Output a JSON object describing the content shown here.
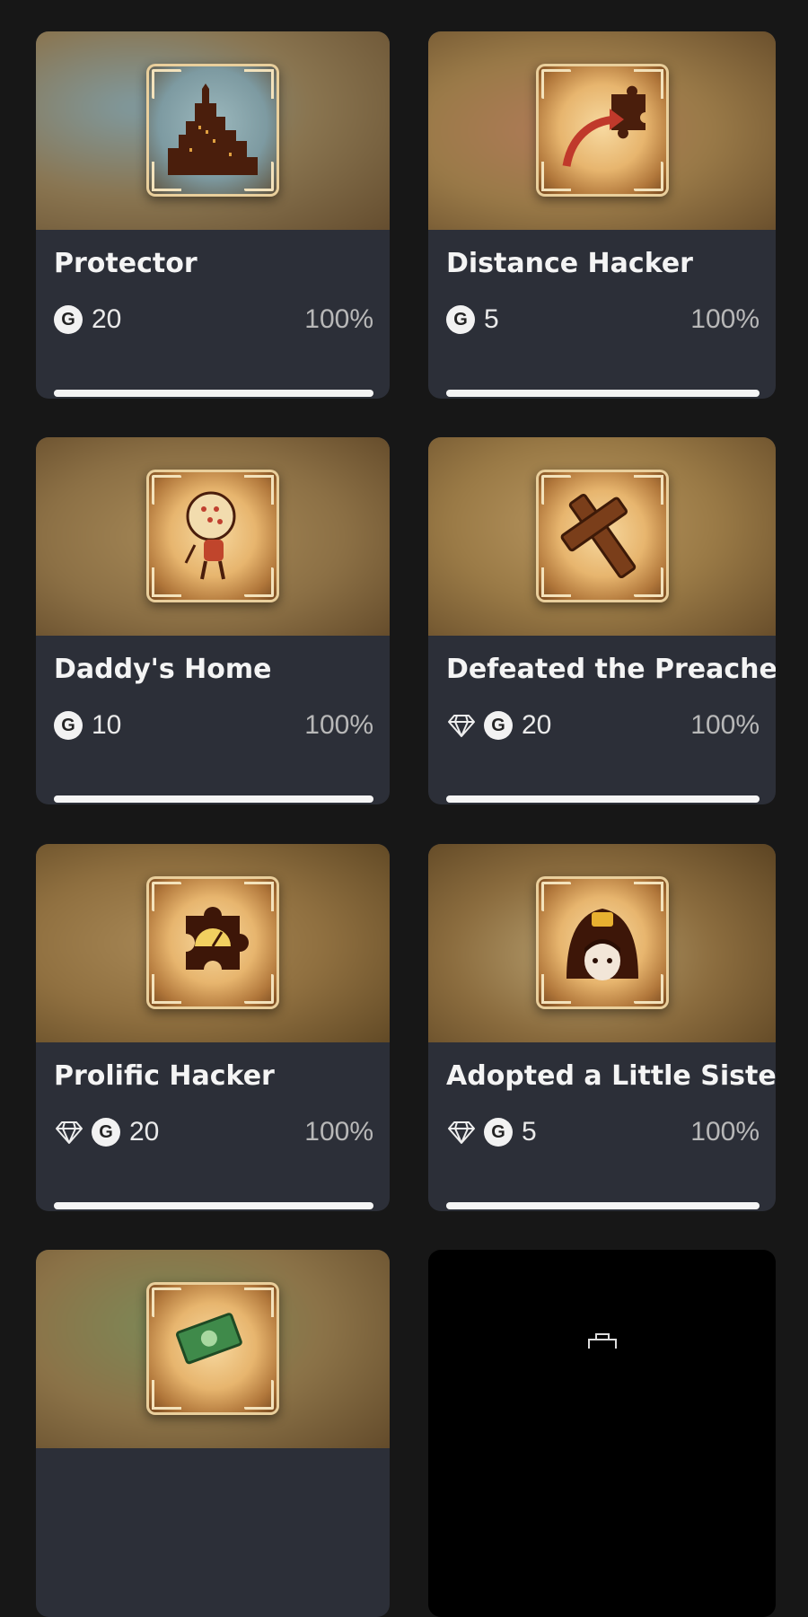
{
  "achievements": [
    {
      "title": "Protector",
      "score": "20",
      "rare": false,
      "percent": "100%",
      "progress": 1.0,
      "icon": "city-icon",
      "bg": "#8a7550"
    },
    {
      "title": "Distance Hacker",
      "score": "5",
      "rare": false,
      "percent": "100%",
      "progress": 1.0,
      "icon": "puzzle-arrow-icon",
      "bg": "#9a7a48"
    },
    {
      "title": "Daddy's Home",
      "score": "10",
      "rare": false,
      "percent": "100%",
      "progress": 1.0,
      "icon": "big-daddy-doll-icon",
      "bg": "#8c7045"
    },
    {
      "title": "Defeated the Preacher",
      "score": "20",
      "rare": true,
      "percent": "100%",
      "progress": 1.0,
      "icon": "cross-icon",
      "bg": "#9a7a46"
    },
    {
      "title": "Prolific Hacker",
      "score": "20",
      "rare": true,
      "percent": "100%",
      "progress": 1.0,
      "icon": "puzzle-gauge-icon",
      "bg": "#907040"
    },
    {
      "title": "Adopted a Little Sister",
      "score": "5",
      "rare": true,
      "percent": "100%",
      "progress": 1.0,
      "icon": "little-sister-icon",
      "bg": "#8b6c3e"
    },
    {
      "icon": "money-icon",
      "bg": "#8c7348"
    }
  ]
}
